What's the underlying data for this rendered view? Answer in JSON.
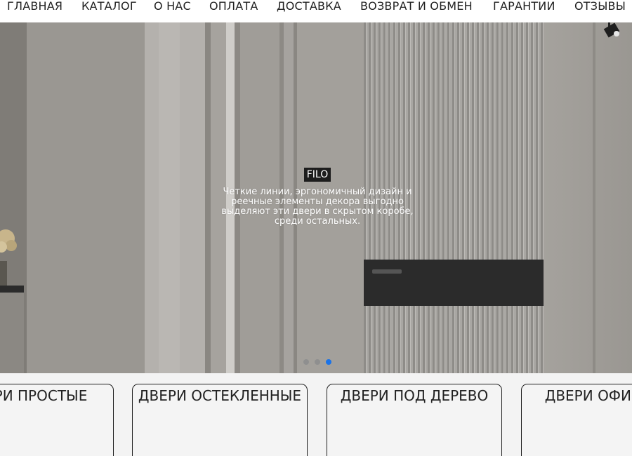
{
  "nav": {
    "items": [
      "ГЛАВНАЯ",
      "КАТАЛОГ",
      "О НАС",
      "ОПЛАТА",
      "ДОСТАВКА",
      "ВОЗВРАТ И ОБМЕН",
      "ГАРАНТИИ",
      "ОТЗЫВЫ"
    ]
  },
  "hero": {
    "title": "FILO",
    "text": "Четкие линии, эргономичный дизайн и реечные элементы декора выгодно выделяют эти двери в скрытом коробе, среди остальных.",
    "slides_total": 3,
    "active_slide": 3,
    "dot_active_color": "#1a73e8"
  },
  "categories": [
    {
      "label": "ДВЕРИ ПРОСТЫЕ"
    },
    {
      "label": "ДВЕРИ ОСТЕКЛЕННЫЕ"
    },
    {
      "label": "ДВЕРИ ПОД ДЕРЕВО"
    },
    {
      "label": "ДВЕРИ ОФИСНЫЕ"
    }
  ]
}
